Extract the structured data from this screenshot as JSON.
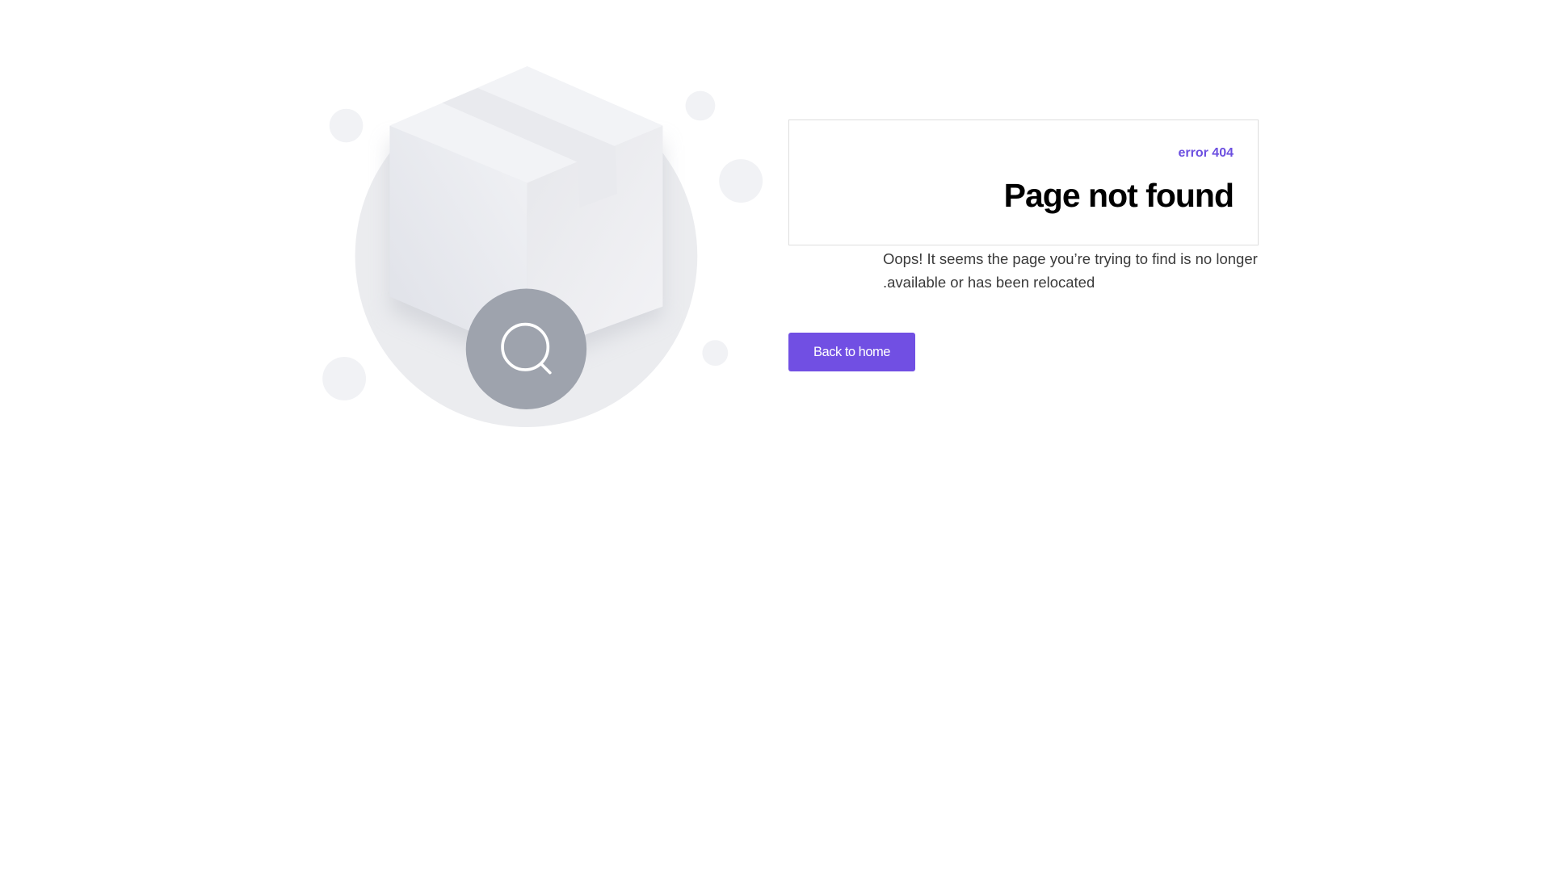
{
  "error_code": "error 404",
  "title": "Page not found",
  "message_line1": "Oops! It seems the page you’re trying to find is no longer",
  "message_line2": ".available or has been relocated",
  "button_label": "Back to home",
  "accent_color": "#714fe3",
  "illustration_icons": [
    "package-box-icon",
    "search-icon"
  ]
}
